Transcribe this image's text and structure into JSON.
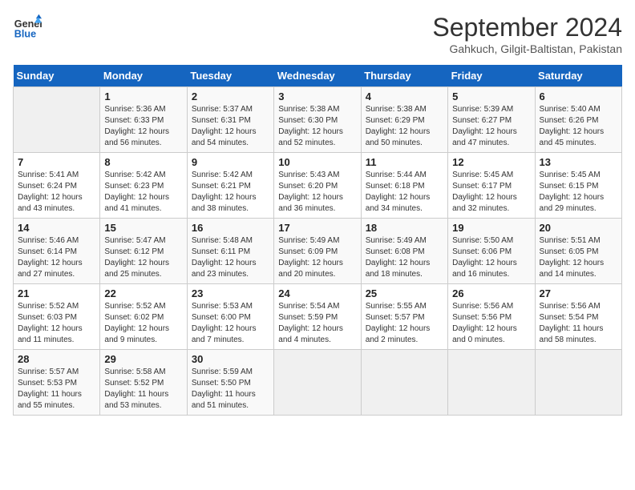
{
  "header": {
    "logo_line1": "General",
    "logo_line2": "Blue",
    "month_title": "September 2024",
    "location": "Gahkuch, Gilgit-Baltistan, Pakistan"
  },
  "weekdays": [
    "Sunday",
    "Monday",
    "Tuesday",
    "Wednesday",
    "Thursday",
    "Friday",
    "Saturday"
  ],
  "days": [
    {
      "num": "",
      "info": ""
    },
    {
      "num": "1",
      "info": "Sunrise: 5:36 AM\nSunset: 6:33 PM\nDaylight: 12 hours\nand 56 minutes."
    },
    {
      "num": "2",
      "info": "Sunrise: 5:37 AM\nSunset: 6:31 PM\nDaylight: 12 hours\nand 54 minutes."
    },
    {
      "num": "3",
      "info": "Sunrise: 5:38 AM\nSunset: 6:30 PM\nDaylight: 12 hours\nand 52 minutes."
    },
    {
      "num": "4",
      "info": "Sunrise: 5:38 AM\nSunset: 6:29 PM\nDaylight: 12 hours\nand 50 minutes."
    },
    {
      "num": "5",
      "info": "Sunrise: 5:39 AM\nSunset: 6:27 PM\nDaylight: 12 hours\nand 47 minutes."
    },
    {
      "num": "6",
      "info": "Sunrise: 5:40 AM\nSunset: 6:26 PM\nDaylight: 12 hours\nand 45 minutes."
    },
    {
      "num": "7",
      "info": "Sunrise: 5:41 AM\nSunset: 6:24 PM\nDaylight: 12 hours\nand 43 minutes."
    },
    {
      "num": "8",
      "info": "Sunrise: 5:42 AM\nSunset: 6:23 PM\nDaylight: 12 hours\nand 41 minutes."
    },
    {
      "num": "9",
      "info": "Sunrise: 5:42 AM\nSunset: 6:21 PM\nDaylight: 12 hours\nand 38 minutes."
    },
    {
      "num": "10",
      "info": "Sunrise: 5:43 AM\nSunset: 6:20 PM\nDaylight: 12 hours\nand 36 minutes."
    },
    {
      "num": "11",
      "info": "Sunrise: 5:44 AM\nSunset: 6:18 PM\nDaylight: 12 hours\nand 34 minutes."
    },
    {
      "num": "12",
      "info": "Sunrise: 5:45 AM\nSunset: 6:17 PM\nDaylight: 12 hours\nand 32 minutes."
    },
    {
      "num": "13",
      "info": "Sunrise: 5:45 AM\nSunset: 6:15 PM\nDaylight: 12 hours\nand 29 minutes."
    },
    {
      "num": "14",
      "info": "Sunrise: 5:46 AM\nSunset: 6:14 PM\nDaylight: 12 hours\nand 27 minutes."
    },
    {
      "num": "15",
      "info": "Sunrise: 5:47 AM\nSunset: 6:12 PM\nDaylight: 12 hours\nand 25 minutes."
    },
    {
      "num": "16",
      "info": "Sunrise: 5:48 AM\nSunset: 6:11 PM\nDaylight: 12 hours\nand 23 minutes."
    },
    {
      "num": "17",
      "info": "Sunrise: 5:49 AM\nSunset: 6:09 PM\nDaylight: 12 hours\nand 20 minutes."
    },
    {
      "num": "18",
      "info": "Sunrise: 5:49 AM\nSunset: 6:08 PM\nDaylight: 12 hours\nand 18 minutes."
    },
    {
      "num": "19",
      "info": "Sunrise: 5:50 AM\nSunset: 6:06 PM\nDaylight: 12 hours\nand 16 minutes."
    },
    {
      "num": "20",
      "info": "Sunrise: 5:51 AM\nSunset: 6:05 PM\nDaylight: 12 hours\nand 14 minutes."
    },
    {
      "num": "21",
      "info": "Sunrise: 5:52 AM\nSunset: 6:03 PM\nDaylight: 12 hours\nand 11 minutes."
    },
    {
      "num": "22",
      "info": "Sunrise: 5:52 AM\nSunset: 6:02 PM\nDaylight: 12 hours\nand 9 minutes."
    },
    {
      "num": "23",
      "info": "Sunrise: 5:53 AM\nSunset: 6:00 PM\nDaylight: 12 hours\nand 7 minutes."
    },
    {
      "num": "24",
      "info": "Sunrise: 5:54 AM\nSunset: 5:59 PM\nDaylight: 12 hours\nand 4 minutes."
    },
    {
      "num": "25",
      "info": "Sunrise: 5:55 AM\nSunset: 5:57 PM\nDaylight: 12 hours\nand 2 minutes."
    },
    {
      "num": "26",
      "info": "Sunrise: 5:56 AM\nSunset: 5:56 PM\nDaylight: 12 hours\nand 0 minutes."
    },
    {
      "num": "27",
      "info": "Sunrise: 5:56 AM\nSunset: 5:54 PM\nDaylight: 11 hours\nand 58 minutes."
    },
    {
      "num": "28",
      "info": "Sunrise: 5:57 AM\nSunset: 5:53 PM\nDaylight: 11 hours\nand 55 minutes."
    },
    {
      "num": "29",
      "info": "Sunrise: 5:58 AM\nSunset: 5:52 PM\nDaylight: 11 hours\nand 53 minutes."
    },
    {
      "num": "30",
      "info": "Sunrise: 5:59 AM\nSunset: 5:50 PM\nDaylight: 11 hours\nand 51 minutes."
    },
    {
      "num": "",
      "info": ""
    },
    {
      "num": "",
      "info": ""
    },
    {
      "num": "",
      "info": ""
    },
    {
      "num": "",
      "info": ""
    },
    {
      "num": "",
      "info": ""
    }
  ]
}
